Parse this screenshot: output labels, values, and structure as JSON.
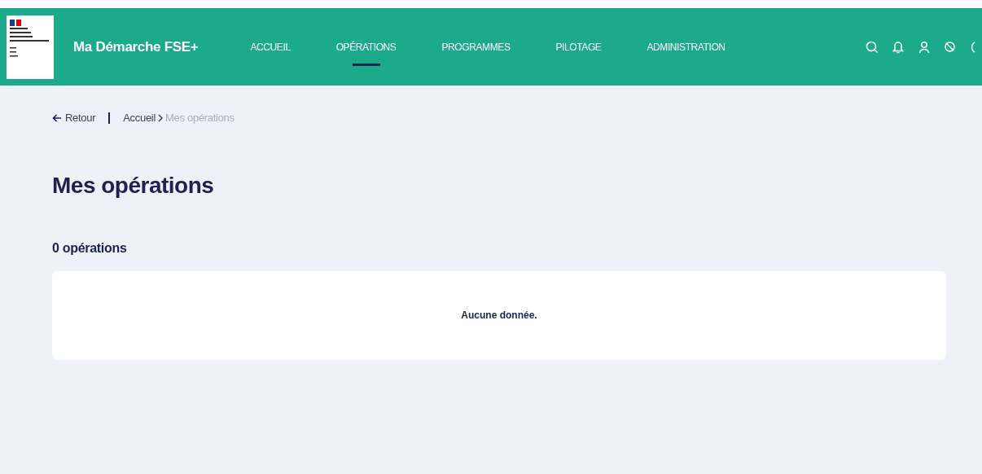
{
  "header": {
    "brand": "Ma Démarche FSE+",
    "nav": [
      {
        "label": "ACCUEIL",
        "selected": false
      },
      {
        "label": "OPÉRATIONS",
        "selected": true
      },
      {
        "label": "PROGRAMMES",
        "selected": false
      },
      {
        "label": "PILOTAGE",
        "selected": false
      },
      {
        "label": "ADMINISTRATION",
        "selected": false
      }
    ]
  },
  "breadcrumb": {
    "back": "Retour",
    "items": [
      {
        "label": "Accueil",
        "current": false
      },
      {
        "label": "Mes opérations",
        "current": true
      }
    ]
  },
  "title": "Mes opérations",
  "count": "0 opérations",
  "empty_message": "Aucune donnée."
}
